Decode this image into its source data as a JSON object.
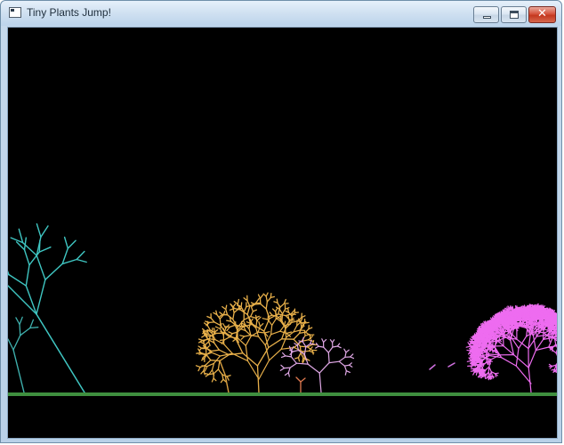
{
  "window": {
    "title": "Tiny Plants Jump!",
    "icon": "app-window-icon",
    "controls": {
      "minimize": {
        "icon": "minimize-icon"
      },
      "maximize": {
        "icon": "maximize-icon"
      },
      "close": {
        "icon": "close-icon",
        "glyph": "✕"
      }
    }
  },
  "game": {
    "background_color": "#000000",
    "ground_color": "#3f8f3f",
    "plants": [
      {
        "name": "cyan-tree",
        "color": "#3fc6c2"
      },
      {
        "name": "cyan-sapling",
        "color": "#3fb0ad"
      },
      {
        "name": "orange-tree",
        "color": "#e8b04a"
      },
      {
        "name": "orange-sprout",
        "color": "#d9a040"
      },
      {
        "name": "lavender-tree",
        "color": "#e0a8e6"
      },
      {
        "name": "coral-seedling",
        "color": "#e07a50"
      },
      {
        "name": "magenta-tree",
        "color": "#ee6cf0"
      }
    ],
    "seeds": [
      {
        "name": "falling-seed-1",
        "color": "#d070e0"
      },
      {
        "name": "falling-seed-2",
        "color": "#d070e0"
      }
    ]
  }
}
